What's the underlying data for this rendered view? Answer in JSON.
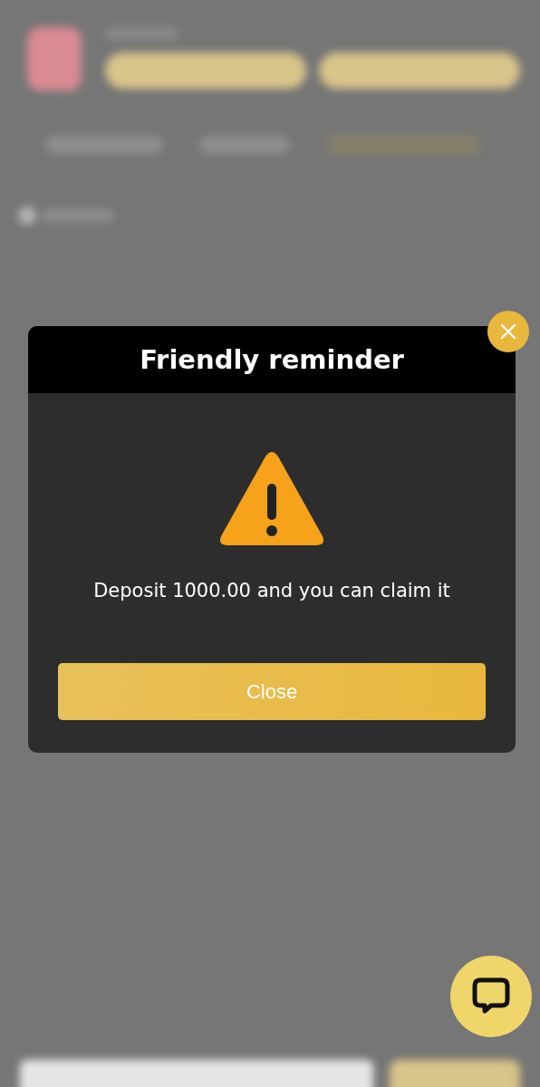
{
  "dialog": {
    "title": "Friendly reminder",
    "message": "Deposit 1000.00 and you can claim it",
    "button": "Close"
  }
}
